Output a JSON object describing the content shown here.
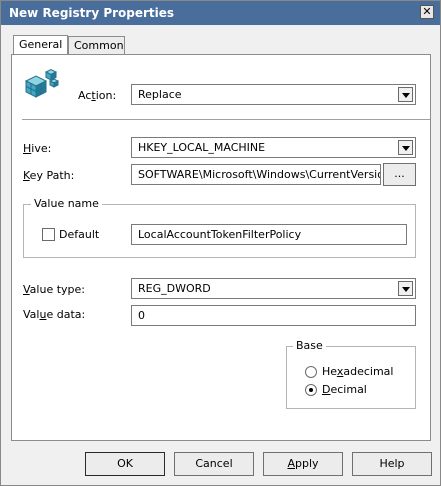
{
  "window": {
    "title": "New Registry Properties",
    "close_glyph": "✕"
  },
  "tabs": [
    {
      "label": "General"
    },
    {
      "label": "Common"
    }
  ],
  "action": {
    "label_pre": "Ac",
    "label_u": "t",
    "label_post": "ion:",
    "value": "Replace"
  },
  "hive": {
    "label_u": "H",
    "label_post": "ive:",
    "value": "HKEY_LOCAL_MACHINE"
  },
  "key_path": {
    "label_u": "K",
    "label_post": "ey Path:",
    "value": "SOFTWARE\\Microsoft\\Windows\\CurrentVersio",
    "browse_label": "..."
  },
  "value_name": {
    "group_label": "Value name",
    "default_label": "Default",
    "default_checked": false,
    "value": "LocalAccountTokenFilterPolicy"
  },
  "value_type": {
    "label_u": "V",
    "label_post": "alue type:",
    "value": "REG_DWORD"
  },
  "value_data": {
    "label_pre": "Val",
    "label_u": "u",
    "label_post": "e data:",
    "value": "0"
  },
  "base": {
    "group_label": "Base",
    "hex": {
      "label_pre": "He",
      "label_u": "x",
      "label_post": "adecimal",
      "checked": false
    },
    "dec": {
      "label_u": "D",
      "label_post": "ecimal",
      "checked": true
    }
  },
  "buttons": {
    "ok": "OK",
    "cancel": "Cancel",
    "apply_u": "A",
    "apply_post": "pply",
    "help": "Help"
  }
}
